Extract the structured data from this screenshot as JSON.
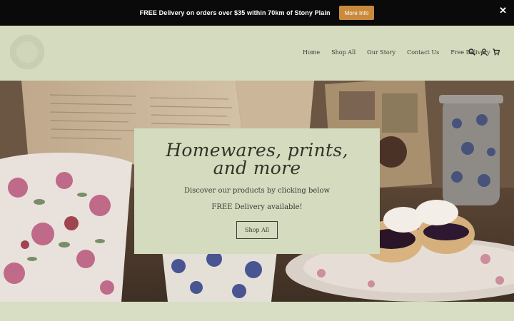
{
  "announcement": {
    "message": "FREE Delivery on orders over $35 within 70km of Stony Plain",
    "button_label": "More Info",
    "close_glyph": "✕",
    "button_color": "#c98a3e",
    "bar_color": "#0a0a0a"
  },
  "header": {
    "logo_icon": "store-logo-seal",
    "nav": [
      {
        "label": "Home"
      },
      {
        "label": "Shop All"
      },
      {
        "label": "Our Story"
      },
      {
        "label": "Contact Us"
      },
      {
        "label": "Free Delivery"
      }
    ],
    "icons": [
      "search-icon",
      "account-icon",
      "cart-icon"
    ],
    "background": "#d4dbbf"
  },
  "hero": {
    "title": "Homewares, prints, and more",
    "subtitle": "Discover our products by clicking below",
    "note": "FREE Delivery available!",
    "button_label": "Shop All",
    "card_color": "#d4dbbf"
  },
  "below": {
    "partial_text": ""
  }
}
